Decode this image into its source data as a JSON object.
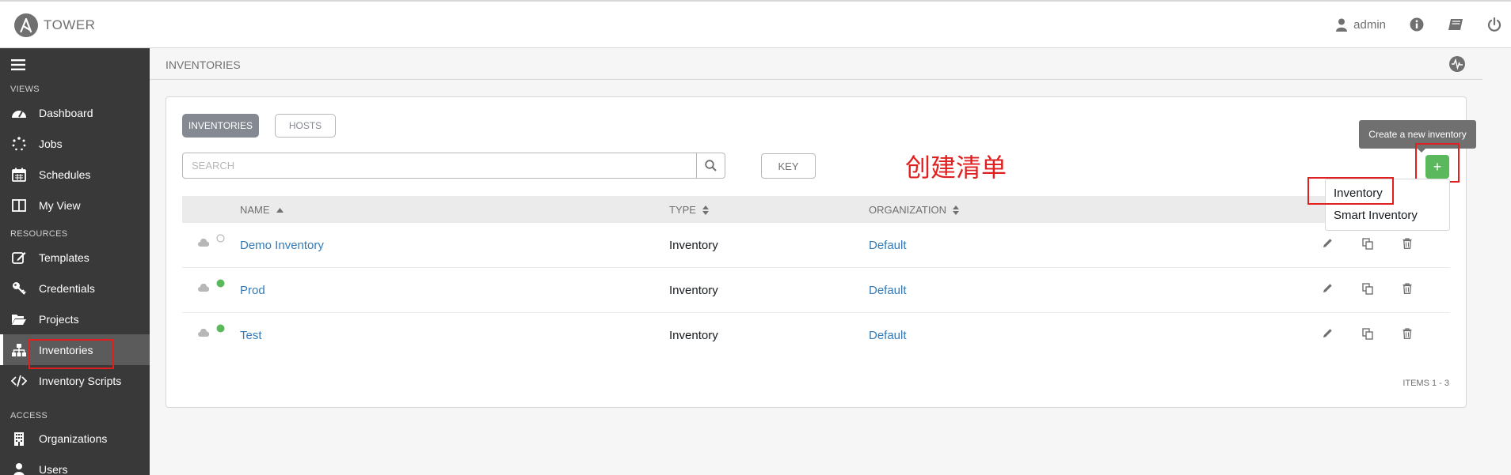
{
  "app": {
    "logo_text": "TOWER"
  },
  "topbar": {
    "user": "admin",
    "icons": [
      "user-icon",
      "info-icon",
      "book-icon",
      "power-icon"
    ]
  },
  "sidebar": {
    "sections": {
      "views": "VIEWS",
      "resources": "RESOURCES",
      "access": "ACCESS"
    },
    "items": [
      {
        "label": "Dashboard",
        "icon": "dashboard-icon"
      },
      {
        "label": "Jobs",
        "icon": "spinner-icon"
      },
      {
        "label": "Schedules",
        "icon": "calendar-icon"
      },
      {
        "label": "My View",
        "icon": "columns-icon"
      },
      {
        "label": "Templates",
        "icon": "edit-icon"
      },
      {
        "label": "Credentials",
        "icon": "key-icon"
      },
      {
        "label": "Projects",
        "icon": "folder-icon"
      },
      {
        "label": "Inventories",
        "icon": "sitemap-icon",
        "active": true
      },
      {
        "label": "Inventory Scripts",
        "icon": "code-icon"
      },
      {
        "label": "Organizations",
        "icon": "building-icon"
      },
      {
        "label": "Users",
        "icon": "user-icon"
      }
    ]
  },
  "breadcrumb": {
    "title": "INVENTORIES"
  },
  "card": {
    "tabs": {
      "inventories": "INVENTORIES",
      "hosts": "HOSTS"
    },
    "search": {
      "placeholder": "SEARCH"
    },
    "key_label": "KEY",
    "annotation": "创建清单",
    "tooltip": "Create a new inventory",
    "add_label": "+",
    "dropdown": {
      "inventory": "Inventory",
      "smart_inventory": "Smart Inventory"
    },
    "columns": {
      "name": "NAME",
      "type": "TYPE",
      "organization": "ORGANIZATION"
    },
    "rows": [
      {
        "name": "Demo Inventory",
        "type": "Inventory",
        "organization": "Default",
        "status": "none"
      },
      {
        "name": "Prod",
        "type": "Inventory",
        "organization": "Default",
        "status": "success"
      },
      {
        "name": "Test",
        "type": "Inventory",
        "organization": "Default",
        "status": "success"
      }
    ],
    "items_label": "ITEMS  1 - 3"
  },
  "colors": {
    "success": "#5cb85c",
    "link": "#337ab7",
    "sidebar": "#393939",
    "annotation": "#e02020"
  }
}
